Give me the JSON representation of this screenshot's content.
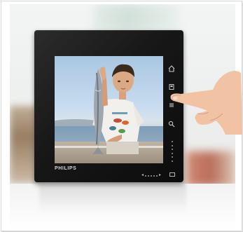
{
  "device": {
    "brand": "PHILIPS"
  },
  "side_controls": [
    {
      "icon": "home-icon"
    },
    {
      "icon": "slideshow-icon"
    },
    {
      "icon": "menu-icon"
    },
    {
      "icon": "zoom-icon"
    }
  ],
  "colors": {
    "frame_body": "#171717",
    "button_glyph": "#c9c9c9"
  }
}
